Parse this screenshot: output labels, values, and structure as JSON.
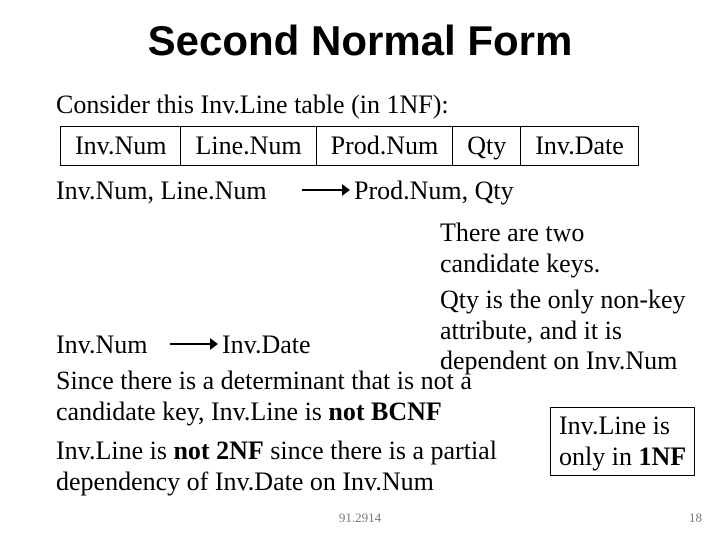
{
  "title": "Second Normal Form",
  "intro": "Consider this Inv.Line table (in 1NF):",
  "table": {
    "cols": [
      "Inv.Num",
      "Line.Num",
      "Prod.Num",
      "Qty",
      "Inv.Date"
    ]
  },
  "fd1": {
    "left": "Inv.Num, Line.Num",
    "right": "Prod.Num, Qty"
  },
  "candidate_text": "There are two candidate keys.",
  "fd2": {
    "left": "Inv.Num",
    "right": "Inv.Date"
  },
  "qty_text": "Qty is the only non-key attribute, and it is dependent on Inv.Num",
  "bcnf": {
    "p1": "Since there is a determinant that is not a candidate key, Inv.Line is ",
    "strong": "not BCNF"
  },
  "box1nf": {
    "l1": "Inv.Line is",
    "l2a": "only in ",
    "l2b": "1NF"
  },
  "not2nf": {
    "p1a": "Inv.Line is ",
    "p1b": "not 2NF",
    "p1c": " since there is a partial dependency of Inv.Date on Inv.Num"
  },
  "footer": {
    "course": "91.2914",
    "page": "18"
  }
}
